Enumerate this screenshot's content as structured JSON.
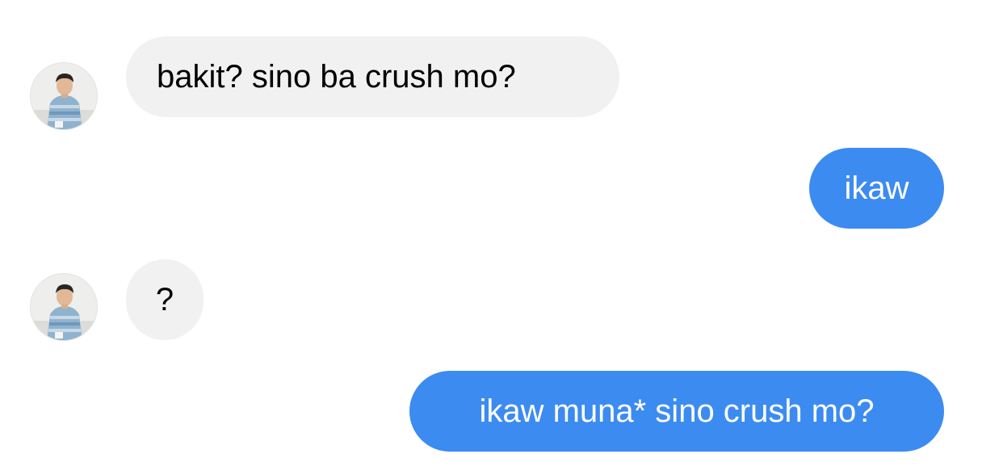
{
  "contact": {
    "avatar_icon": "contact-avatar-photo"
  },
  "colors": {
    "incoming_bubble": "#f1f1f1",
    "outgoing_bubble": "#3c8bf1",
    "incoming_text": "#000000",
    "outgoing_text": "#ffffff"
  },
  "messages": [
    {
      "direction": "incoming",
      "text": "bakit? sino ba crush mo?"
    },
    {
      "direction": "outgoing",
      "text": "ikaw"
    },
    {
      "direction": "incoming",
      "text": "?"
    },
    {
      "direction": "outgoing",
      "text": "ikaw muna* sino crush mo?"
    }
  ]
}
